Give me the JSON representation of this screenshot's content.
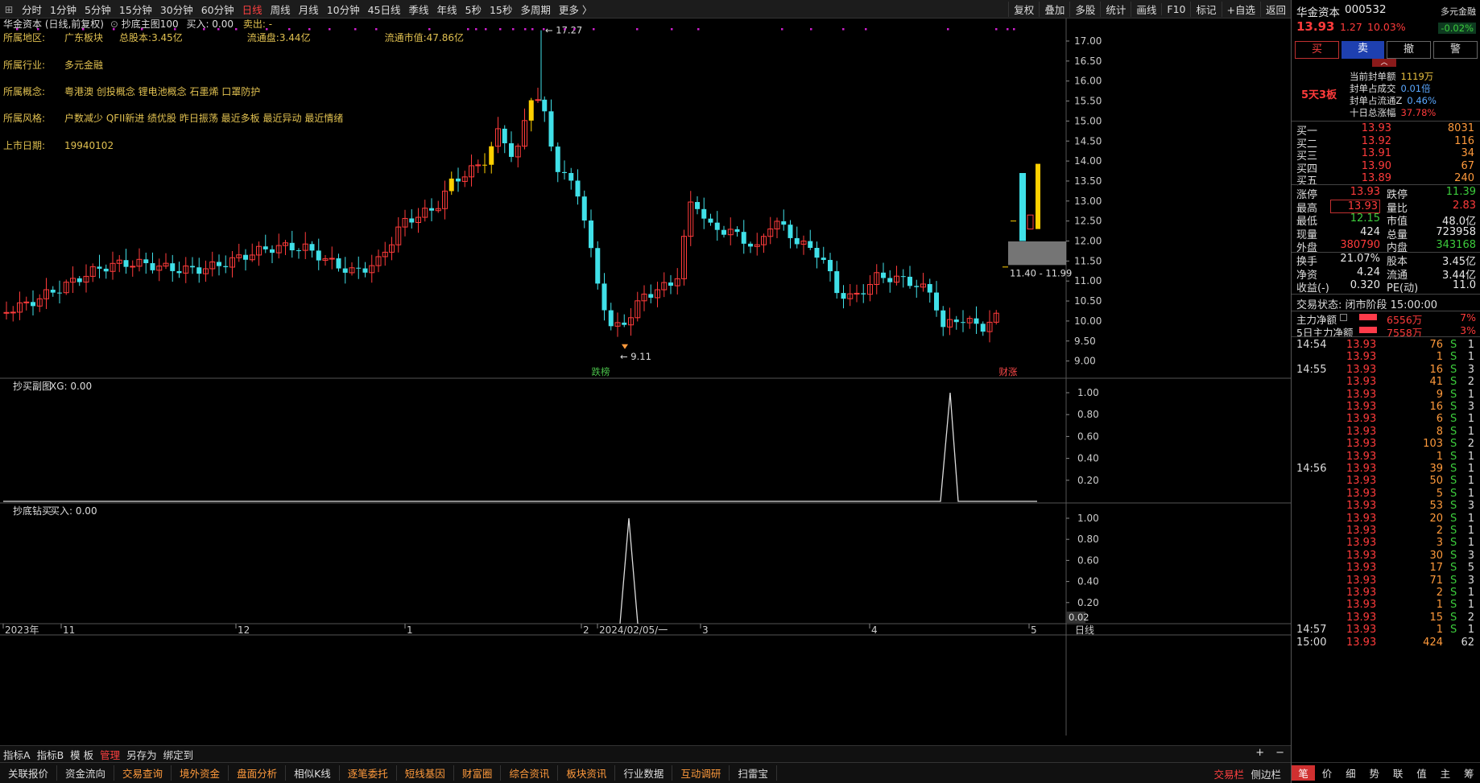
{
  "toolbar": {
    "menu_icon": "grid-icon",
    "timeframes": [
      "分时",
      "1分钟",
      "5分钟",
      "15分钟",
      "30分钟",
      "60分钟",
      "日线",
      "周线",
      "月线",
      "10分钟",
      "45日线",
      "季线",
      "年线",
      "5秒",
      "15秒",
      "多周期",
      "更多 〉"
    ],
    "active_timeframe": "日线",
    "right_tools": [
      "复权",
      "叠加",
      "多股",
      "统计",
      "画线",
      "F10",
      "标记",
      "+自选",
      "返回"
    ]
  },
  "chart_header": {
    "title": "华金资本 (日线,前复权)",
    "indicator": "抄底主图100",
    "buy_label": "买入: 0.00",
    "sell_label": "卖出: -"
  },
  "info_panel": [
    {
      "label": "所属地区:",
      "value": "广东板块",
      "extra": [
        {
          "k": "总股本:",
          "v": "3.45亿"
        },
        {
          "k": "流通盘:",
          "v": "3.44亿"
        },
        {
          "k": "流通市值:",
          "v": "47.86亿"
        }
      ]
    },
    {
      "label": "所属行业:",
      "value": "多元金融"
    },
    {
      "label": "所属概念:",
      "value": "粤港澳 创投概念 锂电池概念 石墨烯 口罩防护"
    },
    {
      "label": "所属风格:",
      "value": "户数减少 QFII新进 绩优股 昨日振荡 最近多板 最近异动 最近情绪"
    },
    {
      "label": "上市日期:",
      "value": "19940102"
    }
  ],
  "main_chart": {
    "y_ticks": [
      "17.00",
      "16.50",
      "16.00",
      "15.50",
      "15.00",
      "14.50",
      "14.00",
      "13.50",
      "13.00",
      "12.50",
      "12.00",
      "11.50",
      "11.00",
      "10.50",
      "10.00",
      "9.50",
      "9.00"
    ],
    "high_label": "17.27",
    "low_label": "9.11",
    "range_label": "11.40 - 11.99",
    "markers": [
      {
        "text": "跌榜",
        "color": "#4ac04a"
      },
      {
        "text": "财涨",
        "color": "#ff4a4a"
      }
    ]
  },
  "sub_chart1": {
    "title": "抄买副图",
    "value_label": "XG: 0.00",
    "y_ticks": [
      "1.00",
      "0.80",
      "0.60",
      "0.40",
      "0.20"
    ]
  },
  "sub_chart2": {
    "title": "抄底钻买",
    "value_label": "买入: 0.00",
    "y_ticks": [
      "1.00",
      "0.80",
      "0.60",
      "0.40",
      "0.20"
    ],
    "current_value": "0.02"
  },
  "x_axis": {
    "labels": [
      "2023年",
      "11",
      "12",
      "1",
      "2",
      "2024/02/05/一",
      "3",
      "4",
      "5"
    ],
    "period": "日线"
  },
  "bottom_tabs": [
    "指标A",
    "指标B",
    "模 板",
    "管理",
    "另存为",
    "绑定到"
  ],
  "bottom_tabs_active": "管理",
  "zoom_buttons": [
    "+",
    "−"
  ],
  "bottom_funcs": [
    "关联报价",
    "资金流向",
    "交易查询",
    "境外资金",
    "盘面分析",
    "相似K线",
    "逐笔委托",
    "短线基因",
    "财富圈",
    "综合资讯",
    "板块资讯",
    "行业数据",
    "互动调研",
    "扫雷宝"
  ],
  "bottom_funcs_highlight": [
    "交易查询",
    "境外资金",
    "盘面分析",
    "逐笔委托",
    "短线基因",
    "财富圈",
    "综合资讯",
    "板块资讯",
    "互动调研"
  ],
  "bottom_right": [
    "交易栏",
    "侧边栏"
  ],
  "stock": {
    "name": "华金资本",
    "code": "000532",
    "sector": "多元金融",
    "sector_change": "-0.02%",
    "price": "13.93",
    "change": "1.27",
    "change_pct": "10.03%"
  },
  "trade_buttons": [
    "买",
    "卖",
    "撤",
    "警"
  ],
  "limit_info": {
    "streak": "5天3板",
    "rows": [
      {
        "k": "当前封单额",
        "v": "1119万",
        "color": "yellow"
      },
      {
        "k": "封单占成交",
        "v": "0.01倍",
        "color": "blue"
      },
      {
        "k": "封单占流通Z",
        "v": "0.46%",
        "color": "blue"
      },
      {
        "k": "十日总涨幅",
        "v": "37.78%",
        "color": "red"
      }
    ]
  },
  "order_book": [
    {
      "label": "买一",
      "price": "13.93",
      "vol": "8031"
    },
    {
      "label": "买二",
      "price": "13.92",
      "vol": "116"
    },
    {
      "label": "买三",
      "price": "13.91",
      "vol": "34"
    },
    {
      "label": "买四",
      "price": "13.90",
      "vol": "67"
    },
    {
      "label": "买五",
      "price": "13.89",
      "vol": "240"
    }
  ],
  "quote_stats": [
    {
      "k1": "涨停",
      "v1": "13.93",
      "c1": "red",
      "k2": "跌停",
      "v2": "11.39",
      "c2": "green"
    },
    {
      "k1": "最高",
      "v1": "13.93",
      "c1": "red",
      "k2": "量比",
      "v2": "2.83",
      "c2": "red"
    },
    {
      "k1": "最低",
      "v1": "12.15",
      "c1": "green",
      "k2": "市值",
      "v2": "48.0亿",
      "c2": "white"
    },
    {
      "k1": "现量",
      "v1": "424",
      "c1": "white",
      "k2": "总量",
      "v2": "723958",
      "c2": "white"
    },
    {
      "k1": "外盘",
      "v1": "380790",
      "c1": "red",
      "k2": "内盘",
      "v2": "343168",
      "c2": "green"
    }
  ],
  "quote_stats2": [
    {
      "k1": "换手",
      "v1": "21.07%",
      "k2": "股本",
      "v2": "3.45亿"
    },
    {
      "k1": "净资",
      "v1": "4.24",
      "k2": "流通",
      "v2": "3.44亿"
    },
    {
      "k1": "收益(-)",
      "v1": "0.320",
      "k2": "PE(动)",
      "v2": "11.0"
    }
  ],
  "trade_status": "交易状态: 闭市阶段 15:00:00",
  "fund_flow": [
    {
      "k": "主力净额",
      "v": "6556万",
      "pct": "7%"
    },
    {
      "k": "5日主力净额",
      "v": "7558万",
      "pct": "3%"
    }
  ],
  "ticks": [
    {
      "time": "14:54",
      "price": "13.93",
      "vol": "76",
      "dir": "S",
      "n": "1"
    },
    {
      "time": "",
      "price": "13.93",
      "vol": "1",
      "dir": "S",
      "n": "1"
    },
    {
      "time": "14:55",
      "price": "13.93",
      "vol": "16",
      "dir": "S",
      "n": "3"
    },
    {
      "time": "",
      "price": "13.93",
      "vol": "41",
      "dir": "S",
      "n": "2"
    },
    {
      "time": "",
      "price": "13.93",
      "vol": "9",
      "dir": "S",
      "n": "1"
    },
    {
      "time": "",
      "price": "13.93",
      "vol": "16",
      "dir": "S",
      "n": "3"
    },
    {
      "time": "",
      "price": "13.93",
      "vol": "6",
      "dir": "S",
      "n": "1"
    },
    {
      "time": "",
      "price": "13.93",
      "vol": "8",
      "dir": "S",
      "n": "1"
    },
    {
      "time": "",
      "price": "13.93",
      "vol": "103",
      "dir": "S",
      "n": "2"
    },
    {
      "time": "",
      "price": "13.93",
      "vol": "1",
      "dir": "S",
      "n": "1"
    },
    {
      "time": "14:56",
      "price": "13.93",
      "vol": "39",
      "dir": "S",
      "n": "1"
    },
    {
      "time": "",
      "price": "13.93",
      "vol": "50",
      "dir": "S",
      "n": "1"
    },
    {
      "time": "",
      "price": "13.93",
      "vol": "5",
      "dir": "S",
      "n": "1"
    },
    {
      "time": "",
      "price": "13.93",
      "vol": "53",
      "dir": "S",
      "n": "3"
    },
    {
      "time": "",
      "price": "13.93",
      "vol": "20",
      "dir": "S",
      "n": "1"
    },
    {
      "time": "",
      "price": "13.93",
      "vol": "2",
      "dir": "S",
      "n": "1"
    },
    {
      "time": "",
      "price": "13.93",
      "vol": "3",
      "dir": "S",
      "n": "1"
    },
    {
      "time": "",
      "price": "13.93",
      "vol": "30",
      "dir": "S",
      "n": "3"
    },
    {
      "time": "",
      "price": "13.93",
      "vol": "17",
      "dir": "S",
      "n": "5"
    },
    {
      "time": "",
      "price": "13.93",
      "vol": "71",
      "dir": "S",
      "n": "3"
    },
    {
      "time": "",
      "price": "13.93",
      "vol": "2",
      "dir": "S",
      "n": "1"
    },
    {
      "time": "",
      "price": "13.93",
      "vol": "1",
      "dir": "S",
      "n": "1"
    },
    {
      "time": "",
      "price": "13.93",
      "vol": "15",
      "dir": "S",
      "n": "2"
    },
    {
      "time": "14:57",
      "price": "13.93",
      "vol": "1",
      "dir": "S",
      "n": "1"
    },
    {
      "time": "15:00",
      "price": "13.93",
      "vol": "424",
      "dir": "",
      "n": "62"
    }
  ],
  "rp_bottom_tabs": [
    "笔",
    "价",
    "细",
    "势",
    "联",
    "值",
    "主",
    "筹"
  ],
  "rp_bottom_active": "笔",
  "colors": {
    "up": "#ff3b3b",
    "down": "#40e0e8",
    "limit_up": "#ffd000",
    "grid": "#333333",
    "axis": "#aaaaaa",
    "dot": "#d020d0"
  }
}
